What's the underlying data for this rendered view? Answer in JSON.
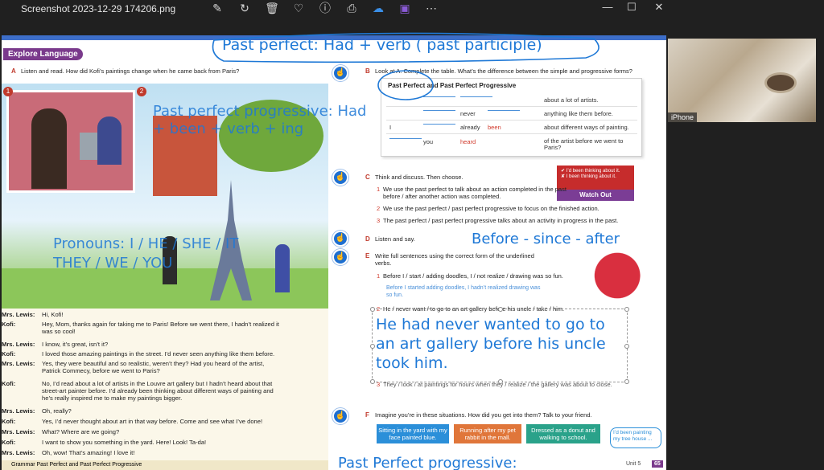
{
  "window": {
    "title": "Screenshot 2023-12-29 174206.png",
    "toolbar_icons": [
      "edit-icon",
      "rotate-icon",
      "delete-icon",
      "favorite-icon",
      "info-icon",
      "print-icon",
      "onedrive-icon",
      "clipchamp-icon",
      "more-icon"
    ],
    "controls": {
      "minimize": "—",
      "maximize": "☐",
      "close": "✕"
    }
  },
  "video": {
    "label": "iPhone"
  },
  "page": {
    "badge": "Explore Language",
    "section_a": {
      "letter": "A",
      "text": "Listen and read. How did Kofi’s paintings change when he came back from Paris?"
    },
    "panel_numbers": [
      "1",
      "2"
    ],
    "dialogue": [
      {
        "speaker": "Mrs. Lewis:",
        "text": "Hi, Kofi!"
      },
      {
        "speaker": "Kofi:",
        "text": "Hey, Mom, thanks again for taking me to Paris! Before we went there, I hadn’t realized it was so cool!"
      },
      {
        "speaker": "Mrs. Lewis:",
        "text": "I know, it’s great, isn’t it?"
      },
      {
        "speaker": "Kofi:",
        "text": "I loved those amazing paintings in the street. I’d never seen anything like them before."
      },
      {
        "speaker": "Mrs. Lewis:",
        "text": "Yes, they were beautiful and so realistic, weren’t they? Had you heard of the artist, Patrick Commecy, before we went to Paris?"
      },
      {
        "speaker": "Kofi:",
        "text": "No, I’d read about a lot of artists in the Louvre art gallery but I hadn’t heard about that street-art painter before. I’d already been thinking about different ways of painting and he’s really inspired me to make my paintings bigger."
      },
      {
        "speaker": "Mrs. Lewis:",
        "text": "Oh, really?"
      },
      {
        "speaker": "Kofi:",
        "text": "Yes, I’d never thought about art in that way before. Come and see what I’ve done!"
      },
      {
        "speaker": "Mrs. Lewis:",
        "text": "What? Where are we going?"
      },
      {
        "speaker": "Kofi:",
        "text": "I want to show you something in the yard. Here! Look! Ta-da!"
      },
      {
        "speaker": "Mrs. Lewis:",
        "text": "Oh, wow! That’s amazing! I love it!"
      }
    ],
    "footer_left": "Grammar Past Perfect and Past Perfect Progressive",
    "section_b": {
      "letter": "B",
      "text": "Look at A. Complete the table. What’s the difference between the simple and progressive forms?"
    },
    "table": {
      "title": "Past Perfect and Past Perfect Progressive",
      "rows": [
        {
          "c1": "",
          "c2": "",
          "c3": "",
          "c4": "about a lot of artists."
        },
        {
          "c1": "",
          "c2": "never",
          "c3": "",
          "c4": "anything like them before."
        },
        {
          "c1": "I",
          "c2": "already",
          "c3": "been",
          "c4": "about different ways of painting."
        },
        {
          "c1": "",
          "c2": "you",
          "c3": "heard",
          "c4": "of the artist before we went to Paris?"
        }
      ]
    },
    "watch_out": {
      "line1": "✔ I’d been thinking about it.",
      "line2": "✘ I been thinking about it.",
      "title": "Watch Out"
    },
    "section_c": {
      "letter": "C",
      "text": "Think and discuss. Then choose.",
      "items": [
        {
          "n": "1",
          "text": "We use the past perfect to talk about an action completed in the past before / after another action was completed."
        },
        {
          "n": "2",
          "text": "We use the past perfect / past perfect progressive to focus on the finished action."
        },
        {
          "n": "3",
          "text": "The past perfect / past perfect progressive talks about an activity in progress in the past."
        }
      ]
    },
    "section_d": {
      "letter": "D",
      "text": "Listen and say."
    },
    "section_e": {
      "letter": "E",
      "text": "Write full sentences using the correct form of the underlined verbs.",
      "items": [
        {
          "n": "1",
          "text": "Before I / start / adding doodles, I / not realize / drawing was so fun."
        },
        {
          "n": "2",
          "text": "He / never want / to go to an art gallery before his uncle / take / him."
        },
        {
          "n": "3",
          "text": "They / look / at paintings for hours when they / realize / the gallery was about to close."
        }
      ],
      "example_answer": "Before I started adding doodles, I hadn’t realized drawing was so fun."
    },
    "section_f": {
      "letter": "F",
      "text": "Imagine you’re in these situations. How did you get into them? Talk to your friend."
    },
    "situations": [
      {
        "text": "Sitting in the yard with my face painted blue.",
        "color": "#2b8fd9"
      },
      {
        "text": "Running after my pet rabbit in the mall.",
        "color": "#e0763a"
      },
      {
        "text": "Dressed as a donut and walking to school.",
        "color": "#2aa28a"
      }
    ],
    "speech_bubble": "I’d been painting my tree house ...",
    "footer_right": {
      "unit": "Unit 5",
      "page": "65"
    }
  },
  "annotations": {
    "past_perfect": "Past perfect:    Had + verb ( past participle)",
    "past_perfect_progressive": [
      "Past perfect progressive: Had",
      "+ been + verb + ing"
    ],
    "pronouns": [
      "Pronouns: I / HE / SHE / IT",
      "THEY / WE / YOU"
    ],
    "before_since_after": "Before - since - after",
    "typed_answer": [
      "He had never wanted to go to",
      "an art gallery before his uncle",
      "took him."
    ],
    "bottom": "Past Perfect progressive:"
  },
  "colors": {
    "ink": "#1e78d6",
    "badge": "#7a3a8c",
    "accent_red": "#d0392b",
    "page_top_bar": "#3d6ec9"
  }
}
